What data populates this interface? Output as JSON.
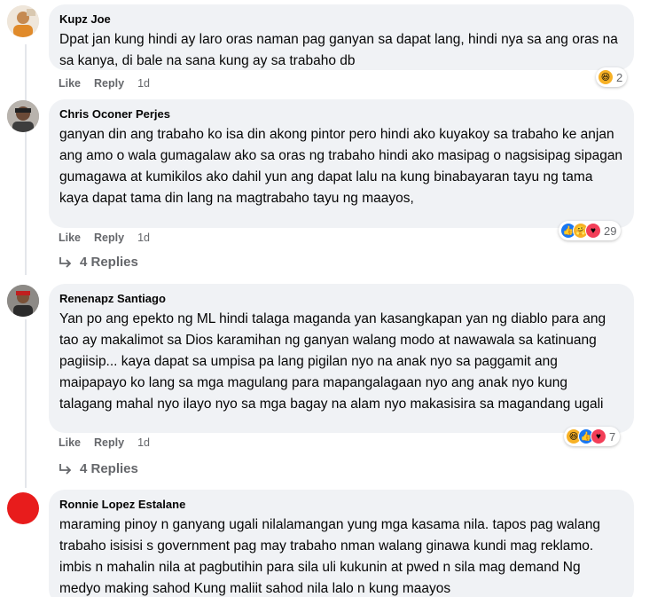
{
  "comments": [
    {
      "author": "Kupz Joe",
      "text": "Dpat jan kung hindi ay laro oras naman pag ganyan sa dapat lang, hindi nya sa ang oras na sa kanya, di bale na sana kung ay sa trabaho db",
      "like": "Like",
      "reply": "Reply",
      "age": "1d",
      "reaction_count": "2",
      "reactions": [
        "haha"
      ]
    },
    {
      "author": "Chris Oconer Perjes",
      "text": "ganyan din ang trabaho ko isa din akong pintor pero hindi ako kuyakoy sa trabaho ke anjan ang amo o wala gumagalaw ako sa oras ng trabaho hindi ako masipag o nagsisipag sipagan gumagawa at kumikilos ako dahil yun ang dapat lalu na kung binabayaran tayu ng tama kaya dapat tama din lang na magtrabaho tayu ng maayos,",
      "like": "Like",
      "reply": "Reply",
      "age": "1d",
      "reaction_count": "29",
      "reactions": [
        "like",
        "care",
        "love"
      ],
      "replies_label": "4 Replies"
    },
    {
      "author": "Renenapz Santiago",
      "text": "Yan po ang epekto ng ML hindi talaga maganda yan kasangkapan yan ng diablo para ang tao ay makalimot sa Dios karamihan ng ganyan walang modo at nawawala sa katinuang pagiisip... kaya dapat sa umpisa pa lang pigilan nyo na anak nyo sa paggamit ang maipapayo ko lang sa mga magulang para mapangalagaan nyo ang anak nyo kung talagang mahal nyo ilayo nyo sa mga bagay na alam nyo makasisira sa magandang ugali",
      "like": "Like",
      "reply": "Reply",
      "age": "1d",
      "reaction_count": "7",
      "reactions": [
        "haha",
        "like",
        "love"
      ],
      "replies_label": "4 Replies"
    },
    {
      "author": "Ronnie Lopez Estalane",
      "text": "maraming pinoy n ganyang ugali nilalamangan yung mga kasama nila. tapos pag walang trabaho isisisi s government pag may trabaho nman walang ginawa kundi mag reklamo. imbis n mahalin nila at pagbutihin para sila uli kukunin at pwed n sila mag demand Ng medyo making sahod Kung maliit sahod nila lalo n kung maayos"
    }
  ],
  "colors": {
    "bubble": "#f0f2f5",
    "meta": "#65676b",
    "red_avatar": "#e81c1c"
  }
}
